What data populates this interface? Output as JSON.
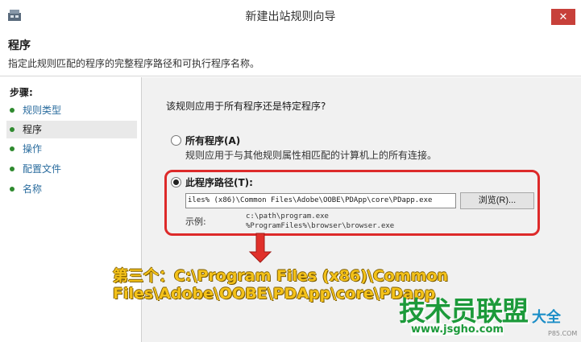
{
  "window": {
    "title": "新建出站规则向导",
    "close_glyph": "✕"
  },
  "header": {
    "title": "程序",
    "description": "指定此规则匹配的程序的完整程序路径和可执行程序名称。"
  },
  "sidebar": {
    "steps_label": "步骤:",
    "items": [
      {
        "label": "规则类型"
      },
      {
        "label": "程序"
      },
      {
        "label": "操作"
      },
      {
        "label": "配置文件"
      },
      {
        "label": "名称"
      }
    ]
  },
  "main": {
    "question": "该规则应用于所有程序还是特定程序?",
    "option_all": {
      "label": "所有程序(A)",
      "description": "规则应用于与其他规则属性相匹配的计算机上的所有连接。"
    },
    "option_path": {
      "label": "此程序路径(T):",
      "value": "iles% (x86)\\Common Files\\Adobe\\OOBE\\PDApp\\core\\PDapp.exe",
      "browse_label": "浏览(R)...",
      "example_label": "示例:",
      "example_lines": [
        "c:\\path\\program.exe",
        "%ProgramFiles%\\browser\\browser.exe"
      ]
    }
  },
  "annotation": {
    "line1": "第三个：C:\\Program Files (x86)\\Common",
    "line2": "Files\\Adobe\\OOBE\\PDApp\\core\\PDapp"
  },
  "watermark": {
    "text": "技术员联盟",
    "text2": "大全",
    "url": "www.jsgho.com",
    "url2": "P85.COM"
  },
  "colors": {
    "annotation": "#f4c21a",
    "highlight_box": "#dd2a2a",
    "step_dot": "#2f8a2f",
    "close_button": "#c7403a"
  }
}
